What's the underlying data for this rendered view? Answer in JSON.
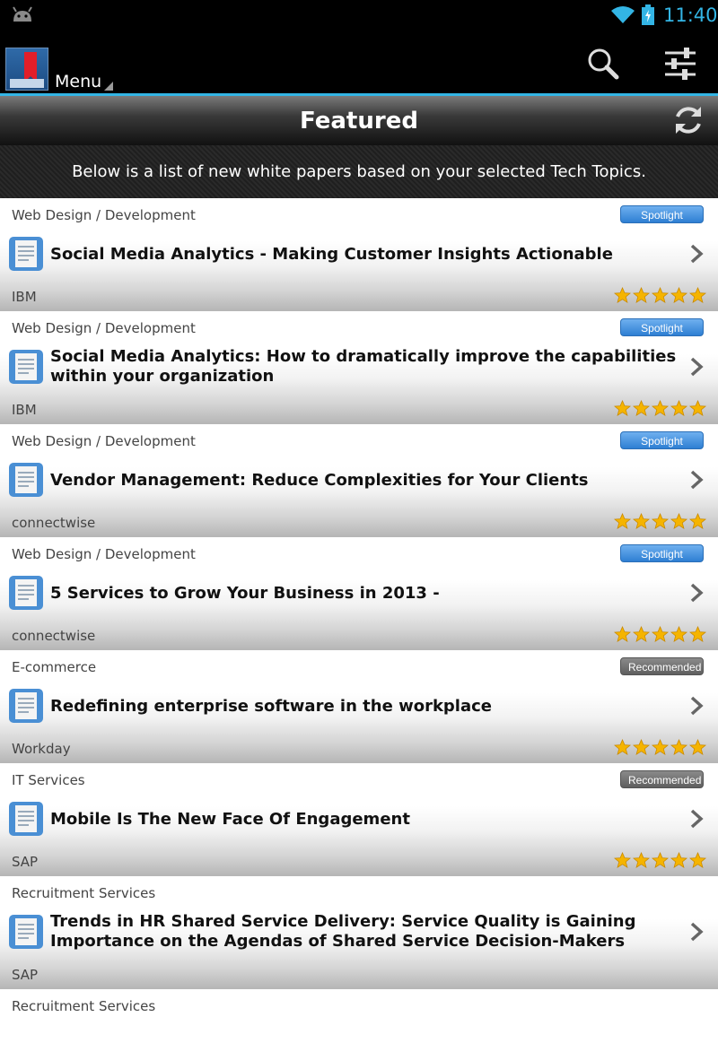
{
  "status": {
    "time": "11:40"
  },
  "action_bar": {
    "menu_label": "Menu"
  },
  "header": {
    "title": "Featured",
    "intro": "Below is a list of new white papers based on your selected Tech Topics."
  },
  "items": [
    {
      "category": "Web Design / Development",
      "badge": "Spotlight",
      "badge_type": "spot",
      "title": "Social Media Analytics - Making Customer Insights Actionable",
      "publisher": "IBM",
      "rating": 5
    },
    {
      "category": "Web Design / Development",
      "badge": "Spotlight",
      "badge_type": "spot",
      "title": "Social Media Analytics:  How to dramatically improve the capabilities within your organization",
      "publisher": "IBM",
      "rating": 5
    },
    {
      "category": "Web Design / Development",
      "badge": "Spotlight",
      "badge_type": "spot",
      "title": "Vendor Management: Reduce Complexities for Your Clients",
      "publisher": "connectwise",
      "rating": 5
    },
    {
      "category": "Web Design / Development",
      "badge": "Spotlight",
      "badge_type": "spot",
      "title": "5 Services to Grow Your Business in 2013 -",
      "publisher": "connectwise",
      "rating": 5
    },
    {
      "category": "E-commerce",
      "badge": "Recommended",
      "badge_type": "rec",
      "title": "Redefining enterprise software in the workplace",
      "publisher": "Workday",
      "rating": 5
    },
    {
      "category": "IT Services",
      "badge": "Recommended",
      "badge_type": "rec",
      "title": "Mobile Is The New Face Of Engagement",
      "publisher": "SAP",
      "rating": 5
    },
    {
      "category": "Recruitment Services",
      "badge": "",
      "badge_type": "",
      "title": "Trends in HR Shared Service Delivery: Service Quality is Gaining Importance on the Agendas of Shared Service Decision-Makers",
      "publisher": "SAP",
      "rating": 0
    },
    {
      "category": "Recruitment Services",
      "badge": "",
      "badge_type": "",
      "title": "",
      "publisher": "",
      "rating": 0
    }
  ],
  "colors": {
    "accent": "#33b5e5",
    "spotlight": "#2e7fd3",
    "recommended": "#6b6b6b",
    "star": "#f5b400"
  },
  "icons": [
    "android-icon",
    "wifi-icon",
    "battery-icon",
    "search-icon",
    "settings-icon",
    "refresh-icon",
    "document-icon",
    "chevron-right-icon",
    "star-icon"
  ]
}
